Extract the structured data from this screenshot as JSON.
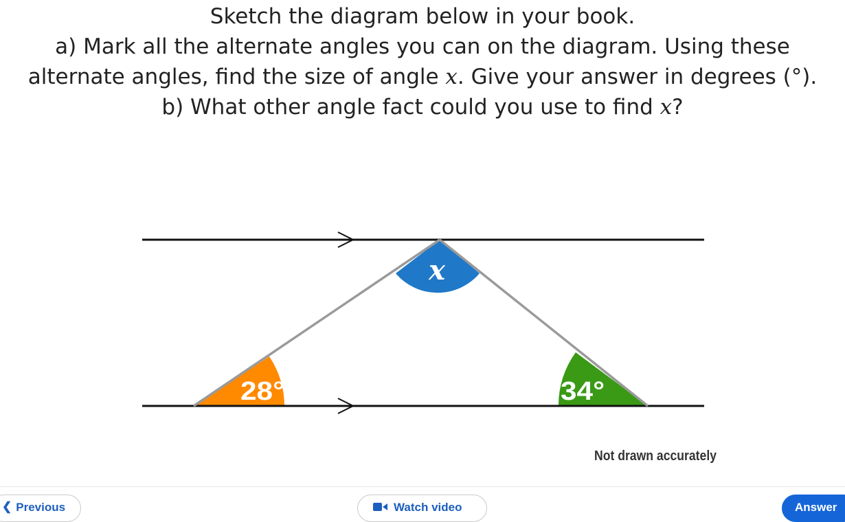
{
  "question": {
    "line1": "Sketch the diagram below in your book.",
    "line2a_prefix": "a) Mark all the alternate angles you can on the diagram. Using these alternate angles, find the size of angle ",
    "line2a_var": "x",
    "line2a_suffix": ". Give your answer in degrees (°).",
    "line2b_prefix": "b) What other angle fact could you use to find ",
    "line2b_var": "x",
    "line2b_suffix": "?"
  },
  "diagram": {
    "angle_top": "x",
    "angle_left": "28°",
    "angle_right": "34°",
    "note": "Not drawn accurately",
    "colors": {
      "angle_top": "#1f78c8",
      "angle_left": "#ff8a00",
      "angle_right": "#3a9a16",
      "lines": "#111111",
      "triangle": "#9a9a9a"
    }
  },
  "footer": {
    "previous_label": "Previous",
    "previous_icon": "chevron-left-icon",
    "video_label": "Watch video",
    "video_icon": "video-camera-icon",
    "answer_label": "Answer"
  }
}
